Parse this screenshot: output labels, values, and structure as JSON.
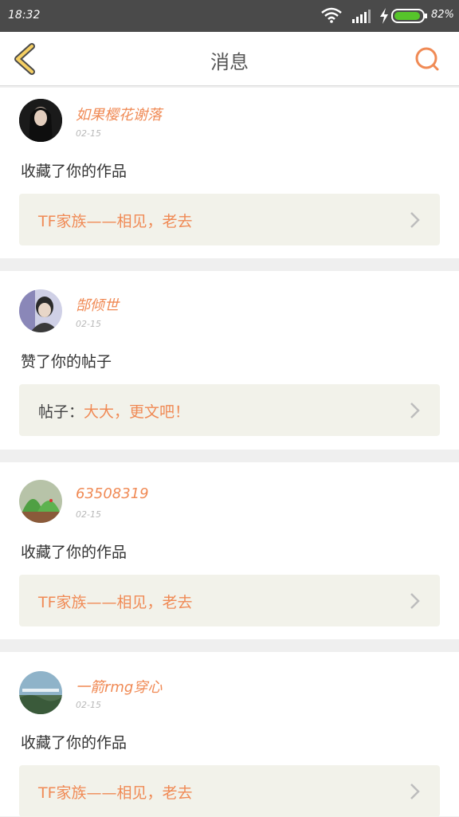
{
  "status_bar": {
    "time": "18:32",
    "battery": "82%"
  },
  "header": {
    "title": "消息"
  },
  "notifications": [
    {
      "username": "如果樱花谢落",
      "date": "02-15",
      "action": "收藏了你的作品",
      "quote_prefix": "",
      "quote": "TF家族——相见，老去"
    },
    {
      "username": "郜倾世",
      "date": "02-15",
      "action": "赞了你的帖子",
      "quote_prefix": "帖子：",
      "quote": "大大，更文吧！"
    },
    {
      "username": "63508319",
      "date": "02-15",
      "action": "收藏了你的作品",
      "quote_prefix": "",
      "quote": "TF家族——相见，老去"
    },
    {
      "username": "一箭rmg穿心",
      "date": "02-15",
      "action": "收藏了你的作品",
      "quote_prefix": "",
      "quote": "TF家族——相见，老去"
    }
  ],
  "colors": {
    "accent": "#f08a55",
    "back_arrow": "#f0c85a",
    "quote_bg": "#f2f2ea"
  }
}
